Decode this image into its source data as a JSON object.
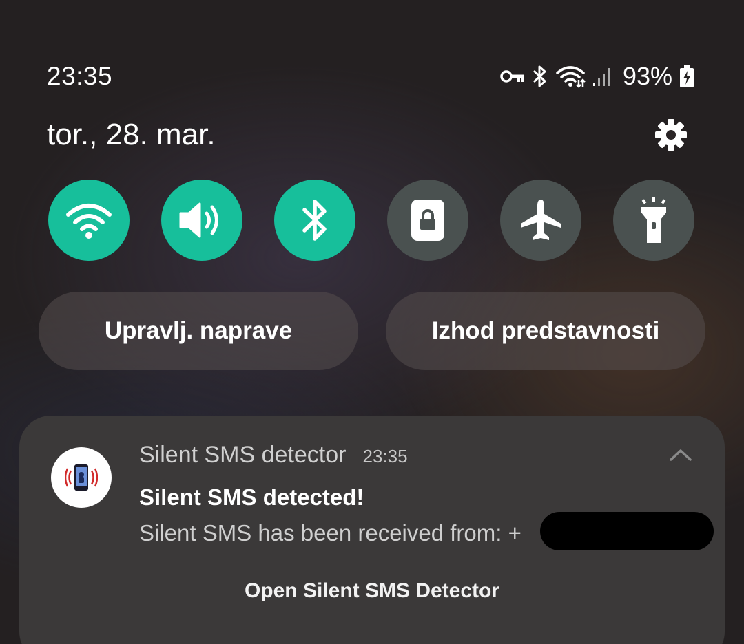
{
  "status_bar": {
    "time": "23:35",
    "battery_percent": "93%",
    "icons": [
      "vpn-key-icon",
      "bluetooth-icon",
      "wifi-icon",
      "signal-icon",
      "battery-charging-icon"
    ]
  },
  "header": {
    "date": "tor., 28. mar.",
    "settings_icon": "gear-icon"
  },
  "quick_toggles": [
    {
      "name": "wifi",
      "icon": "wifi-icon",
      "state": "on"
    },
    {
      "name": "sound",
      "icon": "volume-icon",
      "state": "on"
    },
    {
      "name": "bluetooth",
      "icon": "bluetooth-icon",
      "state": "on"
    },
    {
      "name": "screen-lock",
      "icon": "lock-icon",
      "state": "off"
    },
    {
      "name": "airplane-mode",
      "icon": "airplane-icon",
      "state": "off"
    },
    {
      "name": "flashlight",
      "icon": "flashlight-icon",
      "state": "off"
    }
  ],
  "buttons": {
    "device_control": "Upravlj. naprave",
    "media_output": "Izhod predstavnosti"
  },
  "notification": {
    "app_name": "Silent SMS detector",
    "time": "23:35",
    "title": "Silent SMS detected!",
    "body": "Silent SMS has been received from: +",
    "action": "Open Silent SMS Detector"
  },
  "colors": {
    "toggle_on": "#17bf9b",
    "toggle_off": "#4a5150",
    "card_bg": "#3b3939"
  }
}
